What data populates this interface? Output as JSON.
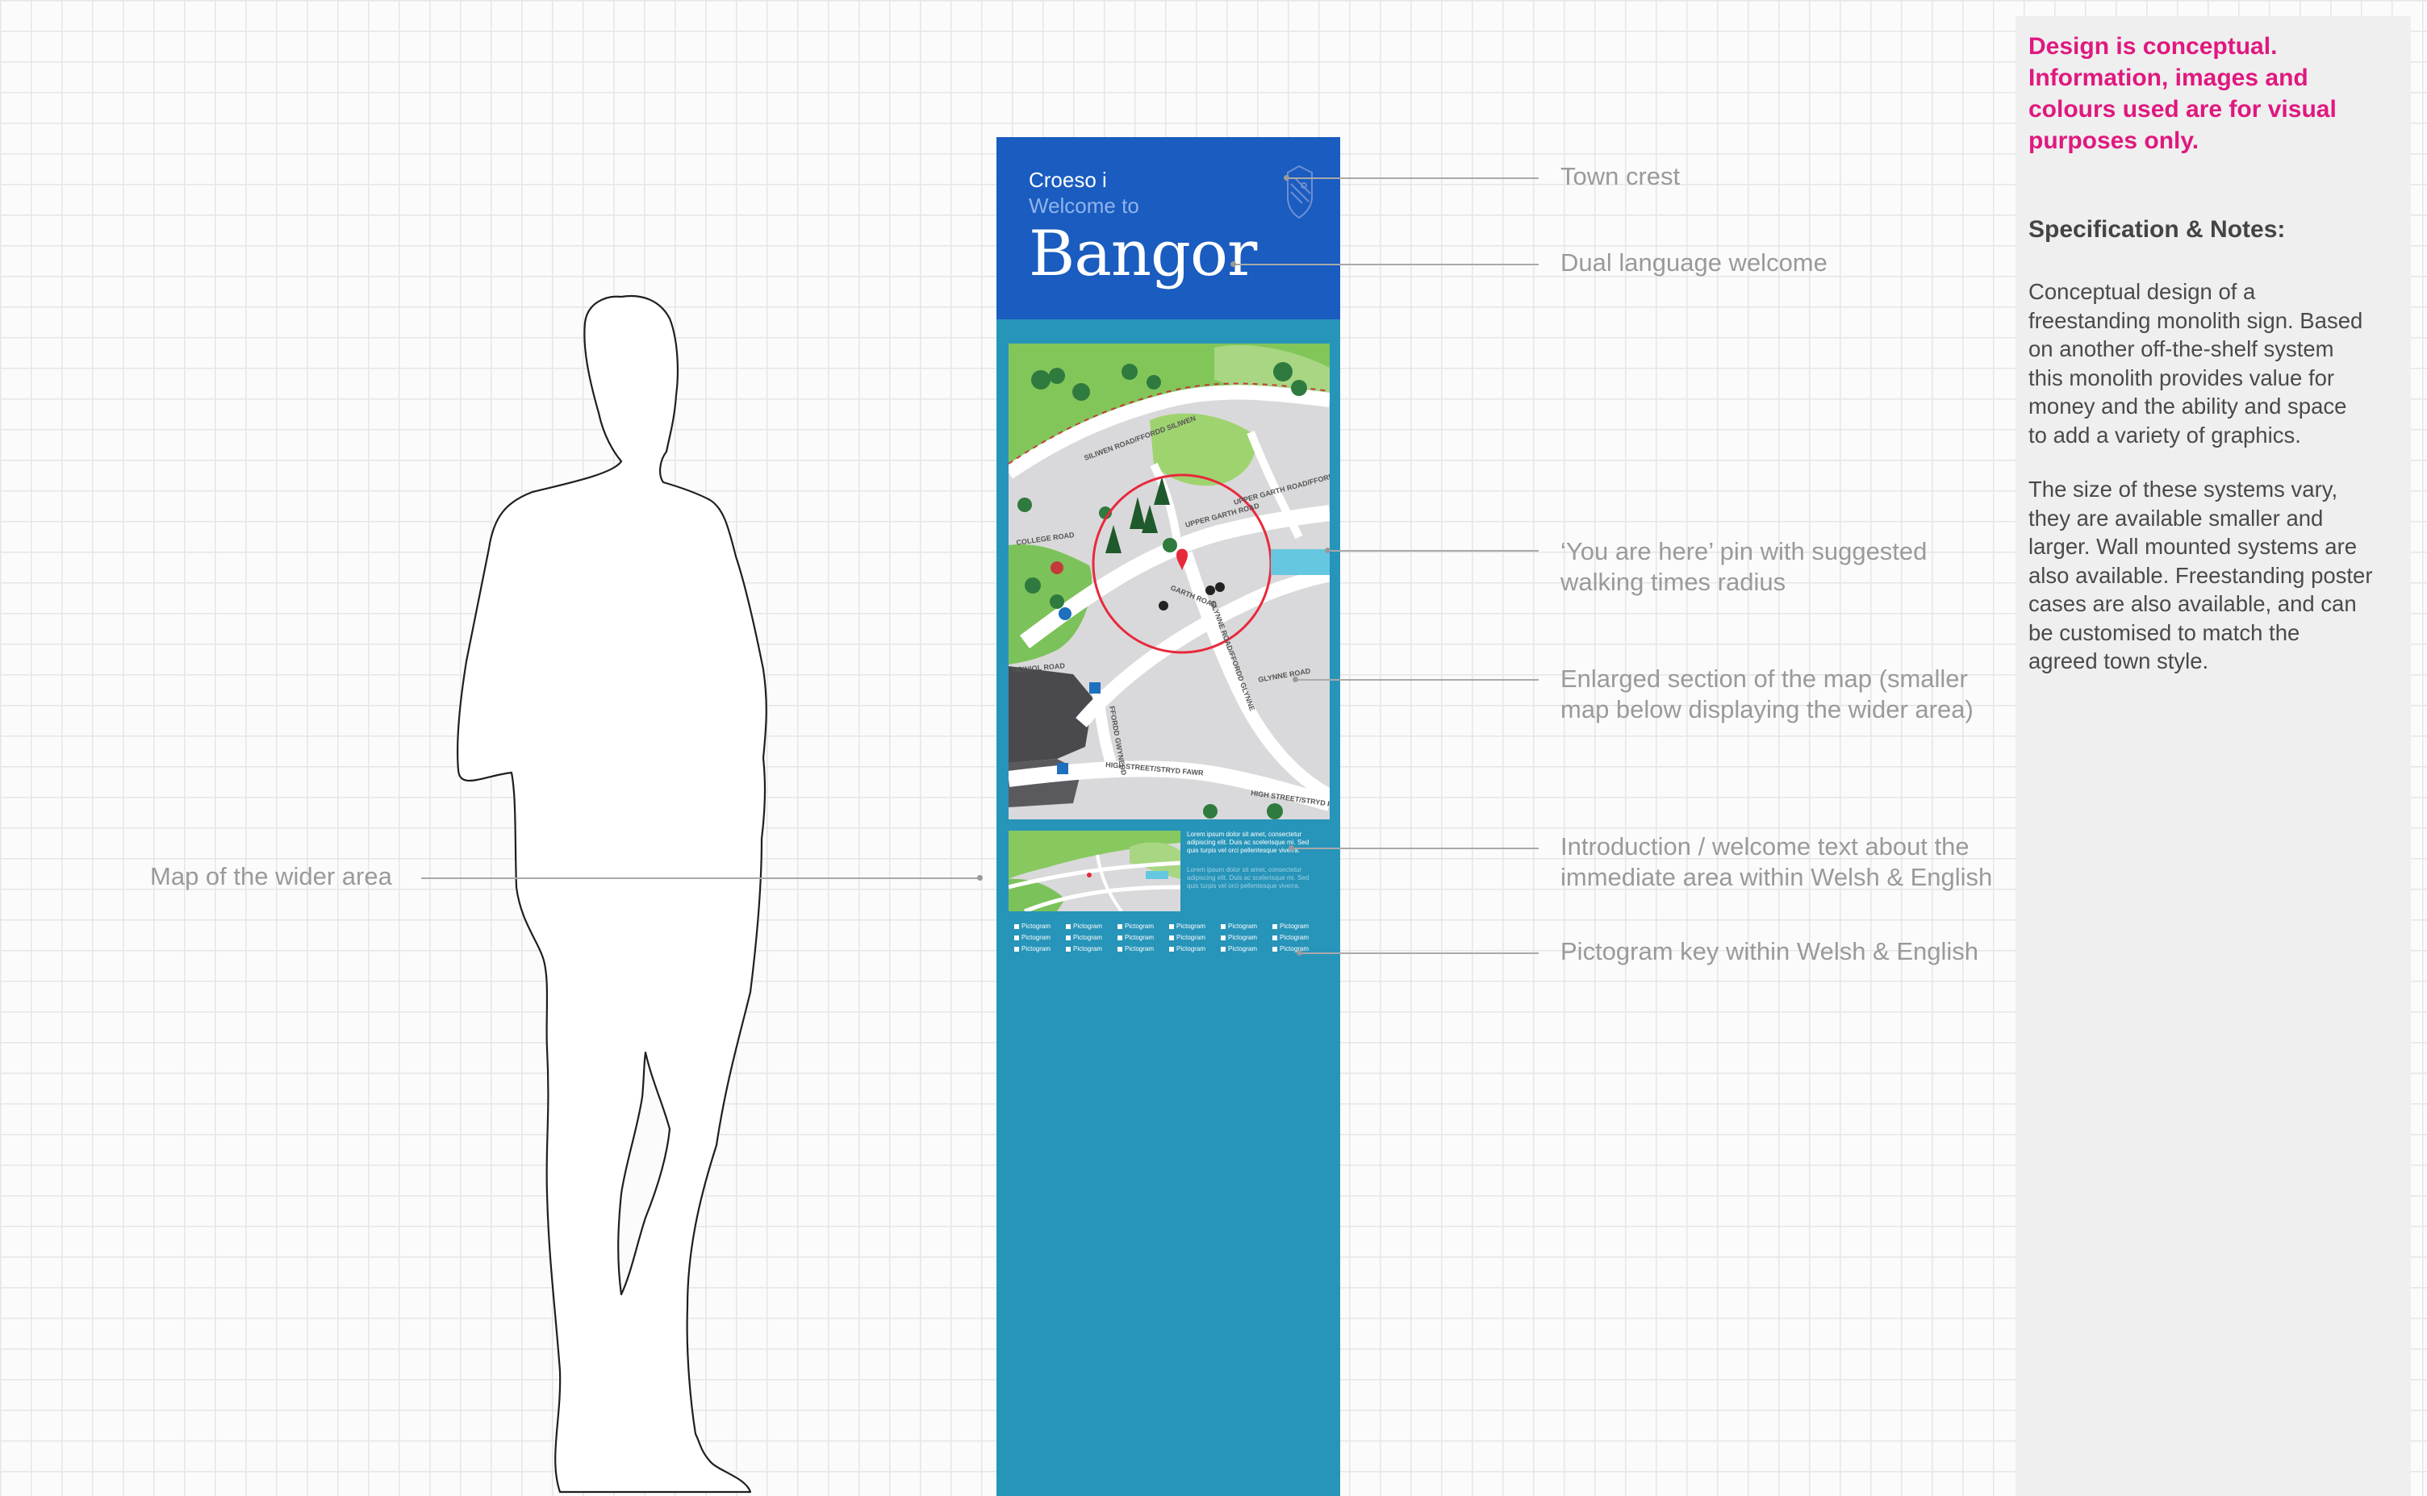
{
  "monolith": {
    "welsh_greeting": "Croeso i",
    "english_greeting": "Welcome to",
    "town_name": "Bangor",
    "intro_text_welsh": [
      "Lorem ipsum dolor sit amet, consectetur",
      "adipiscing elit. Duis ac scelerisque mi. Sed",
      "quis turpis vel orci pellentesque viverra."
    ],
    "intro_text_english": [
      "Lorem ipsum dolor sit amet, consectetur",
      "adipiscing elit. Duis ac scelerisque mi. Sed",
      "quis turpis vel orci pellentesque viverra."
    ],
    "pictogram_label": "Pictogram",
    "map_labels": {
      "road_1": "SILIWEN ROAD/FFORDD SILIWEN",
      "road_2": "UPPER GARTH ROAD/FFORDD GARTH UCHAF",
      "road_3": "UPPER GARTH ROAD",
      "road_4": "COLLEGE ROAD",
      "road_5": "GARTH ROAD",
      "road_6": "GLYNNE ROAD/FFORDD GLYNNE",
      "road_7": "DEINIOL ROAD",
      "road_8": "HIGH STREET/STRYD FAWR",
      "road_9": "HIGH STREET/STRYD FAWR",
      "road_10": "FFORDD GWYNEDD",
      "road_11": "GLYNNE ROAD"
    },
    "colors": {
      "header": "#1a5cbf",
      "body": "#2794b9",
      "pin": "#e8293b"
    }
  },
  "callouts": {
    "town_crest": "Town crest",
    "dual_language": "Dual language welcome",
    "you_are_here_1": "‘You are here’ pin with suggested",
    "you_are_here_2": "walking times radius",
    "enlarged_1": "Enlarged section of the map (smaller",
    "enlarged_2": "map below displaying the wider area)",
    "intro_1": "Introduction / welcome text about the",
    "intro_2": "immediate area within Welsh & English",
    "pictogram_key": "Pictogram key within Welsh & English",
    "wider_area": "Map of the wider area"
  },
  "notes": {
    "disclaimer": [
      "Design is conceptual.",
      "Information, images and",
      "colours used are for visual",
      "purposes only."
    ],
    "heading": "Specification & Notes:",
    "paragraph_1": [
      "Conceptual design of a",
      "freestanding monolith sign. Based",
      "on another off-the-shelf system",
      "this monolith provides value for",
      "money and the ability and space",
      "to add a variety of graphics."
    ],
    "paragraph_2": [
      "The size of these systems vary,",
      "they are available smaller and",
      "larger. Wall mounted systems are",
      "also available. Freestanding poster",
      "cases are also available, and can",
      "be customised to match the",
      "agreed town style."
    ],
    "colors": {
      "disclaimer": "#e0187f"
    }
  }
}
